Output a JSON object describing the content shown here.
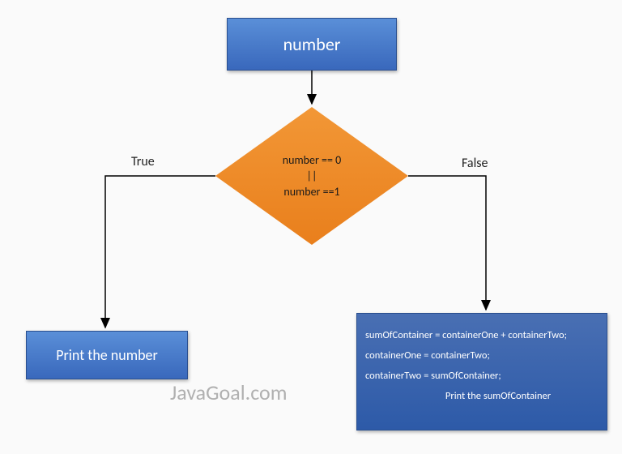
{
  "top": {
    "label": "number"
  },
  "decision": {
    "line1": "number == 0",
    "op": "||",
    "line2": "number ==1"
  },
  "labels": {
    "true": "True",
    "false": "False"
  },
  "true_branch": {
    "text": "Print the number"
  },
  "false_branch": {
    "line1": "sumOfContainer = containerOne + containerTwo;",
    "line2": "containerOne = containerTwo;",
    "line3": "containerTwo = sumOfContainer;",
    "line4": "Print the sumOfContainer"
  },
  "watermark": "JavaGoal.com"
}
